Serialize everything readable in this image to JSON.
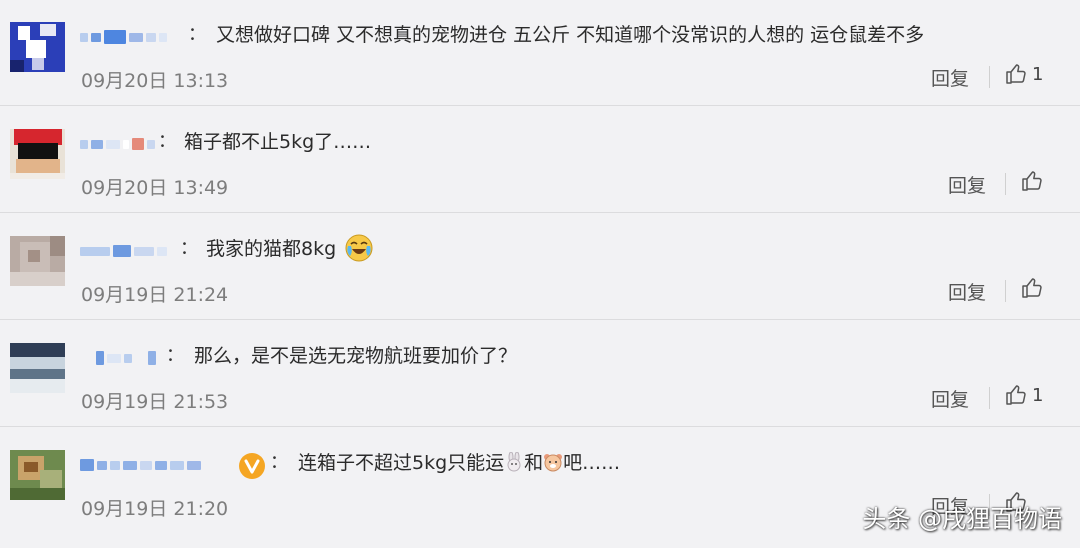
{
  "comments": [
    {
      "text": "又想做好口碑 又不想真的宠物进仓 五公斤 不知道哪个没常识的人想的 运仓鼠差不多",
      "time": "09月20日 13:13",
      "reply_label": "回复",
      "likes": "1"
    },
    {
      "text": "箱子都不止5kg了……",
      "time": "09月20日 13:49",
      "reply_label": "回复",
      "likes": ""
    },
    {
      "text": "我家的猫都8kg",
      "emoji": "cry-laugh-emoji",
      "time": "09月19日 21:24",
      "reply_label": "回复",
      "likes": ""
    },
    {
      "text": "那么，是不是选无宠物航班要加价了？",
      "time": "09月19日 21:53",
      "reply_label": "回复",
      "likes": "1"
    },
    {
      "text_before": "连箱子不超过5kg只能运",
      "text_middle": "和",
      "text_after": "吧……",
      "badge": "verified-v-badge",
      "time": "09月19日 21:20",
      "reply_label": "回复",
      "likes": ""
    }
  ],
  "colon": "：",
  "watermark": "头条 @戌狸百物语",
  "colors": {
    "background": "#f2f2f4",
    "time_text": "#7d7d7d",
    "badge": "#f5a623",
    "name_blur": "#8fb0e6"
  }
}
